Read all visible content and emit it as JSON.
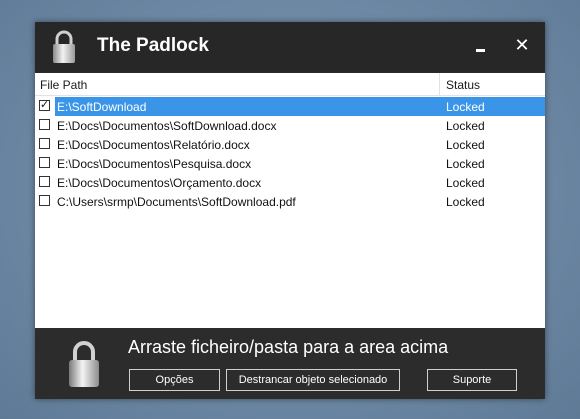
{
  "window": {
    "title": "The Padlock",
    "minimize_icon": "minimize-icon",
    "close_label": "✕"
  },
  "list": {
    "headers": {
      "path": "File Path",
      "status": "Status"
    },
    "rows": [
      {
        "path": "E:\\SoftDownload",
        "status": "Locked",
        "checked": true,
        "selected": true
      },
      {
        "path": "E:\\Docs\\Documentos\\SoftDownload.docx",
        "status": "Locked",
        "checked": false,
        "selected": false
      },
      {
        "path": "E:\\Docs\\Documentos\\Relatório.docx",
        "status": "Locked",
        "checked": false,
        "selected": false
      },
      {
        "path": "E:\\Docs\\Documentos\\Pesquisa.docx",
        "status": "Locked",
        "checked": false,
        "selected": false
      },
      {
        "path": "E:\\Docs\\Documentos\\Orçamento.docx",
        "status": "Locked",
        "checked": false,
        "selected": false
      },
      {
        "path": "C:\\Users\\srmp\\Documents\\SoftDownload.pdf",
        "status": "Locked",
        "checked": false,
        "selected": false
      }
    ]
  },
  "footer": {
    "message": "Arraste ficheiro/pasta para a area acima",
    "options_label": "Opções",
    "unlock_label": "Destrancar objeto selecionado",
    "support_label": "Suporte"
  },
  "colors": {
    "selection": "#3a95e8",
    "window_dark": "#2a2a2a",
    "desktop": "#6f8aa6"
  }
}
